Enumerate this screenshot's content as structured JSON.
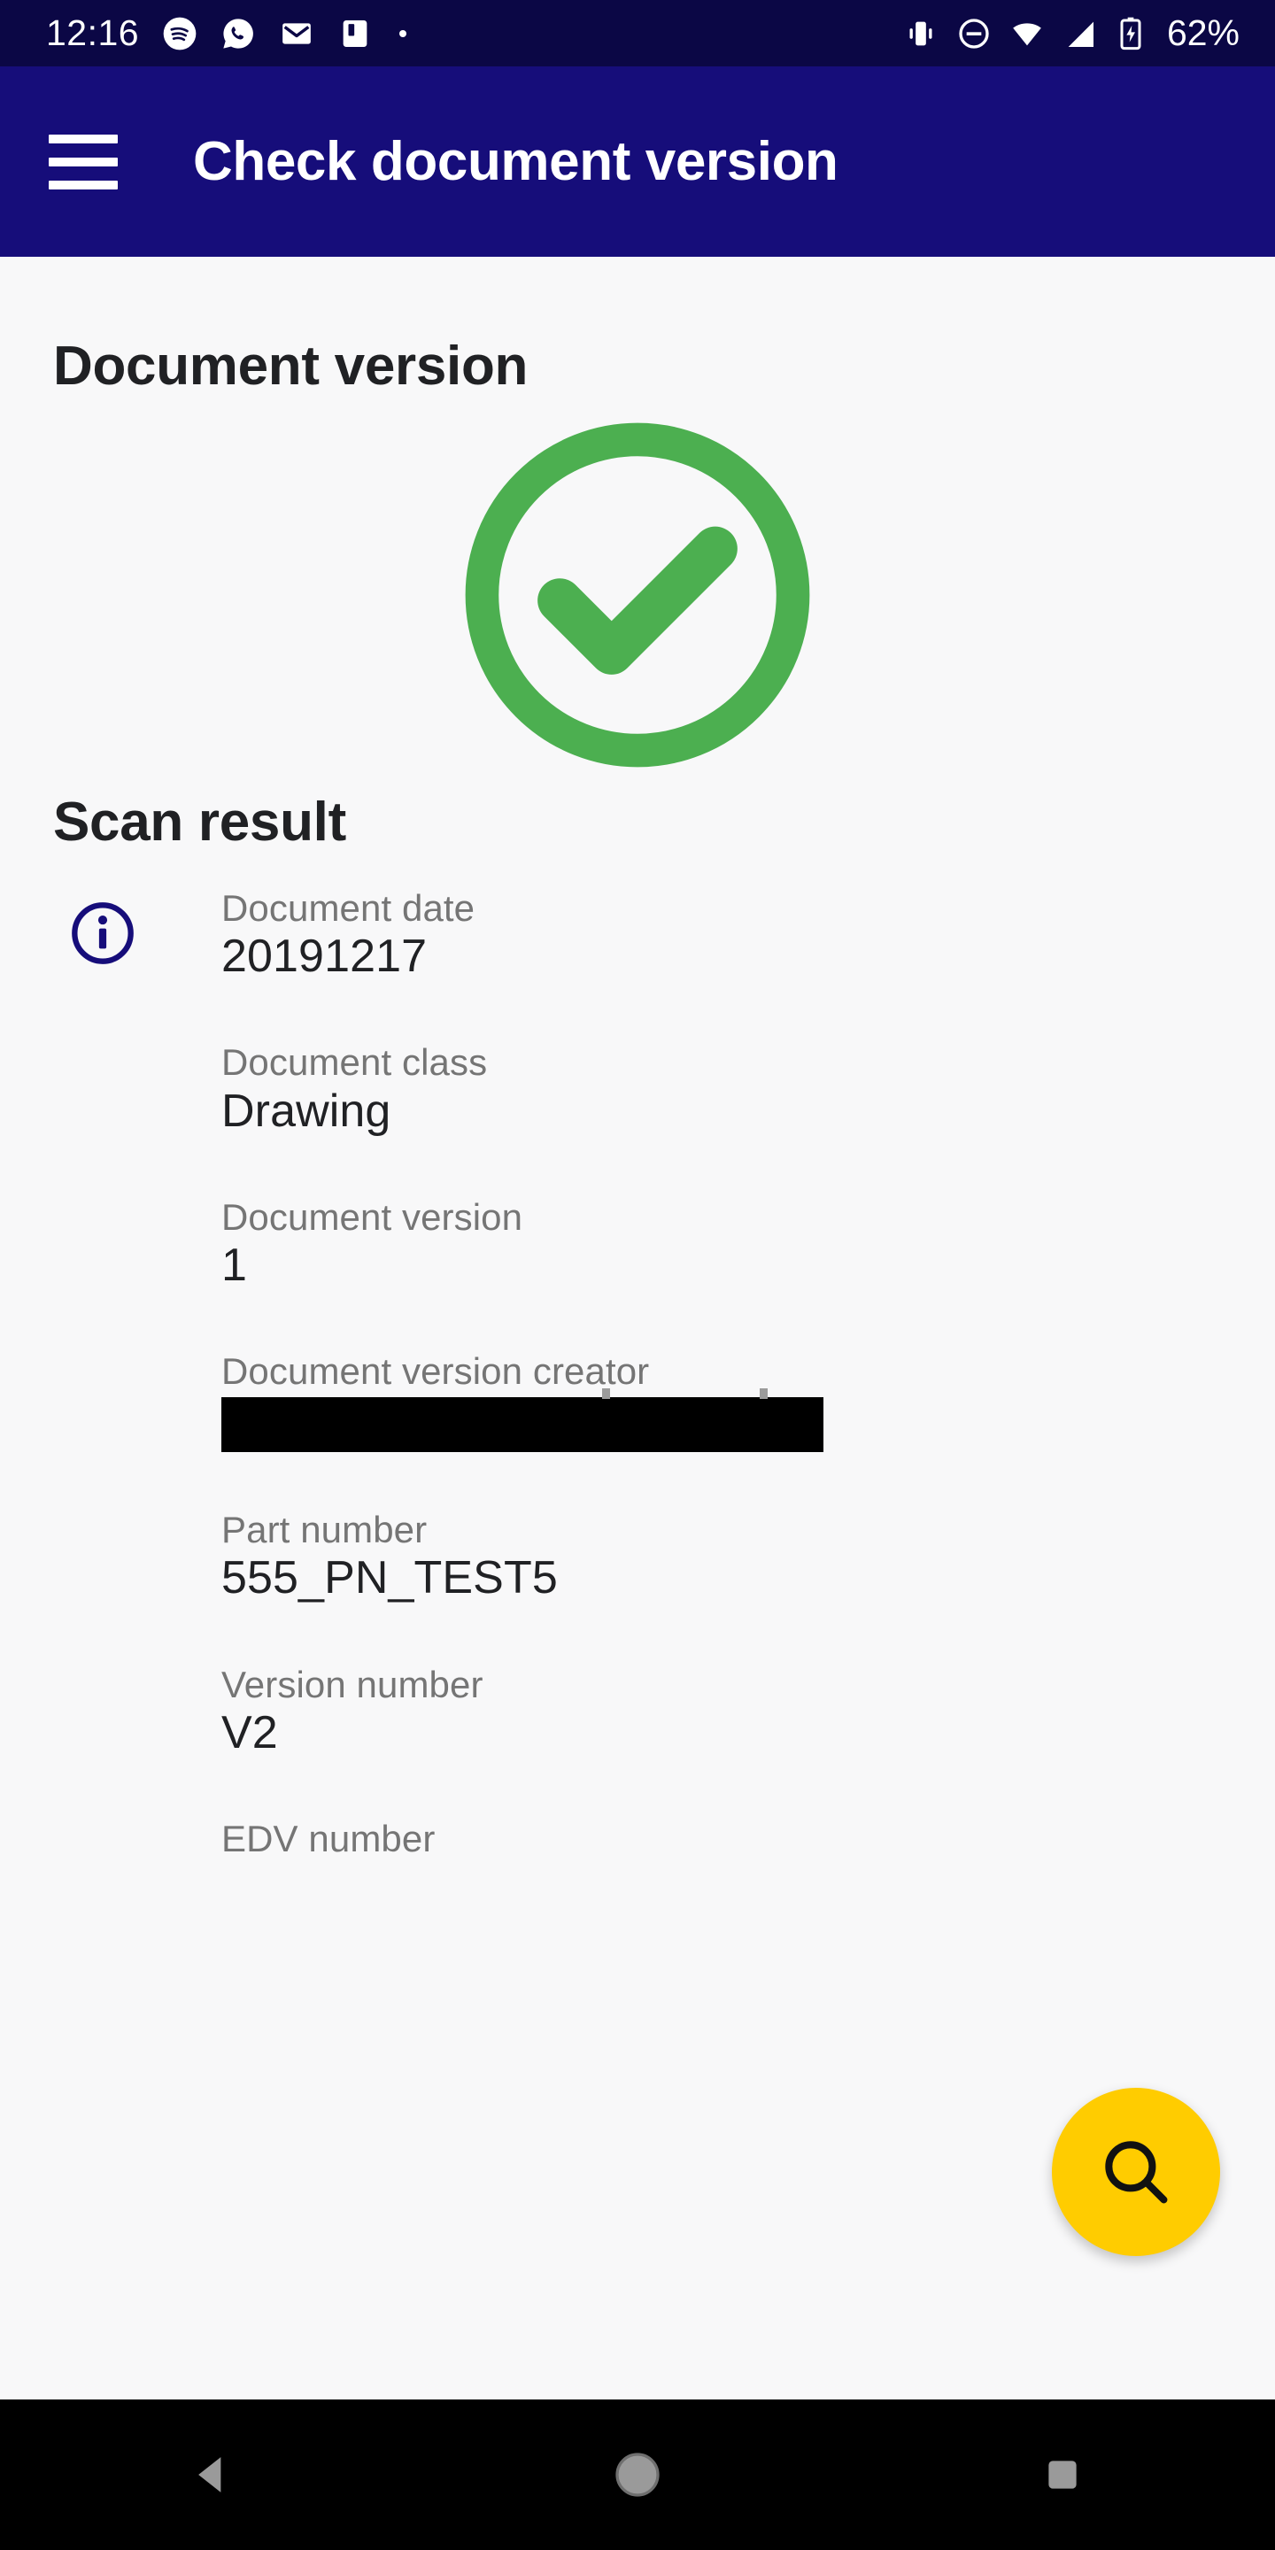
{
  "status_bar": {
    "time": "12:16",
    "battery_percent": "62%",
    "left_icons": [
      "spotify-icon",
      "whatsapp-icon",
      "gmail-icon",
      "app-icon",
      "dot-icon"
    ],
    "right_icons": [
      "vibrate-icon",
      "do-not-disturb-icon",
      "wifi-icon",
      "signal-icon",
      "battery-charging-icon"
    ],
    "background_color": "#0b0745"
  },
  "app_bar": {
    "menu_icon": "hamburger-menu-icon",
    "title": "Check document version",
    "background_color": "#160d7a"
  },
  "main": {
    "page_title": "Document version",
    "status_icon": "check-circle-icon",
    "status_color": "#4caf50",
    "scan_result_title": "Scan result",
    "info_icon": "info-icon",
    "info_icon_color": "#160d7a",
    "fields": [
      {
        "label": "Document date",
        "value": "20191217",
        "redacted": false
      },
      {
        "label": "Document class",
        "value": "Drawing",
        "redacted": false
      },
      {
        "label": "Document version",
        "value": "1",
        "redacted": false
      },
      {
        "label": "Document version creator",
        "value": "",
        "redacted": true
      },
      {
        "label": "Part number",
        "value": "555_PN_TEST5",
        "redacted": false
      },
      {
        "label": "Version number",
        "value": "V2",
        "redacted": false
      },
      {
        "label": "EDV number",
        "value": "",
        "redacted": false
      }
    ]
  },
  "fab": {
    "icon": "search-icon",
    "background_color": "#ffcc00"
  },
  "nav_bar": {
    "back_icon": "back-triangle-icon",
    "home_icon": "home-circle-icon",
    "recents_icon": "recents-square-icon",
    "background_color": "#000000"
  }
}
